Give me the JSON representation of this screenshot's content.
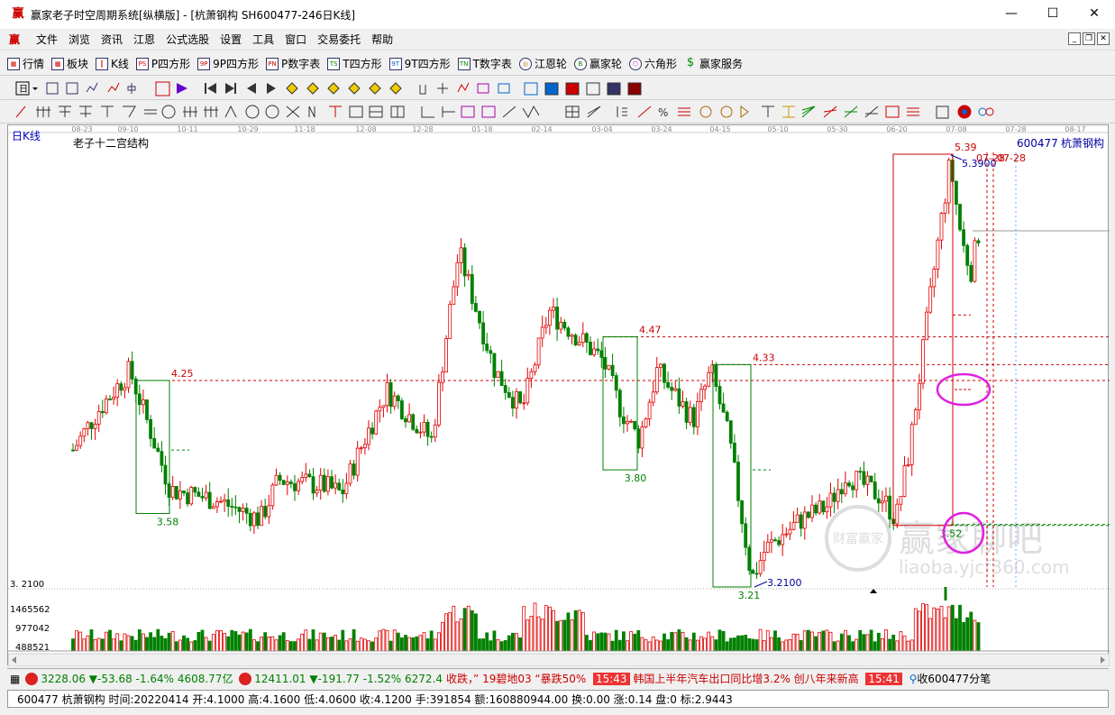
{
  "window": {
    "title": "赢家老子时空周期系统[纵横版] - [杭萧钢构  SH600477-246日K线]",
    "app_icon_text": "赢",
    "minimize": "—",
    "maximize": "☐",
    "close": "✕"
  },
  "menu": {
    "logo": "赢",
    "items": [
      "文件",
      "浏览",
      "资讯",
      "江恩",
      "公式选股",
      "设置",
      "工具",
      "窗口",
      "交易委托",
      "帮助"
    ]
  },
  "toolbar1": {
    "items": [
      {
        "icon": "grid-icon",
        "label": "行情"
      },
      {
        "icon": "blocks-icon",
        "label": "板块"
      },
      {
        "icon": "candle-icon",
        "label": "K线"
      },
      {
        "icon": "ps-icon",
        "label": "P四方形"
      },
      {
        "icon": "9p-icon",
        "label": "9P四方形"
      },
      {
        "icon": "pn-icon",
        "label": "P数字表"
      },
      {
        "icon": "ts-icon",
        "label": "T四方形"
      },
      {
        "icon": "9t-icon",
        "label": "9T四方形"
      },
      {
        "icon": "tn-icon",
        "label": "T数字表"
      },
      {
        "icon": "wheel-icon",
        "label": "江恩轮"
      },
      {
        "icon": "big-icon",
        "label": "赢家轮"
      },
      {
        "icon": "hexagon-icon",
        "label": "六角形"
      },
      {
        "icon": "dollar-icon",
        "label": "赢家服务"
      }
    ]
  },
  "chart": {
    "period_label": "日K线",
    "indicator_title": "老子十二宫结构",
    "stock_code": "600477",
    "stock_name": "杭萧钢构",
    "date_ticks": [
      "08-23",
      "09-10",
      "10-11",
      "10-29",
      "11-18",
      "12-08",
      "12-28",
      "01-18",
      "02-14",
      "03-04",
      "03-24",
      "04-15",
      "05-10",
      "05-30",
      "06-20",
      "07-08",
      "07-28",
      "08-17"
    ],
    "price_labels": {
      "high_box1": "4.25",
      "low_box1": "3.58",
      "high_box2": "4.47",
      "low_box2": "3.80",
      "high_box3": "4.33",
      "low_box3": "3.21",
      "low_marker": "3.2100",
      "high_box4": "5.39",
      "high_marker": "5.3900",
      "low_box4": "3.52",
      "date_marker": "07-28",
      "date_marker2": "07-28"
    },
    "axis_low_price": "3. 2100",
    "volume_ticks": [
      "1465562",
      "977042",
      "488521"
    ],
    "watermark_title": "赢家聊吧",
    "watermark_url": "liaoba.yjcf360.com",
    "watermark_logo_text": "财富赢家",
    "colors": {
      "up": "#e00000",
      "down": "#008000",
      "box_red": "#cc0000",
      "box_green": "#008000",
      "circle": "#e020e0",
      "grid": "#bbbbbb"
    }
  },
  "status": {
    "sh_index": "3228.06",
    "sh_change": "▼-53.68",
    "sh_pct": "-1.64%",
    "sh_amount": "4608.77亿",
    "sz_index": "12411.01",
    "sz_change": "▼-191.77",
    "sz_pct": "-1.52%",
    "sz_amount": "6272.4",
    "news1": "收跌，”  19碧地03 “暴跌50%",
    "time1": "15:43",
    "news2": "韩国上半年汽车出口同比增3.2% 创八年来新高",
    "time2": "15:41",
    "receive": "收600477分笔"
  },
  "infobar": {
    "text": "600477 杭萧钢构 时间:20220414 开:4.1000 高:4.1600 低:4.0600 收:4.1200 手:391854 额:160880944.00 换:0.00 涨:0.14 盘:0 标:2.9443"
  }
}
